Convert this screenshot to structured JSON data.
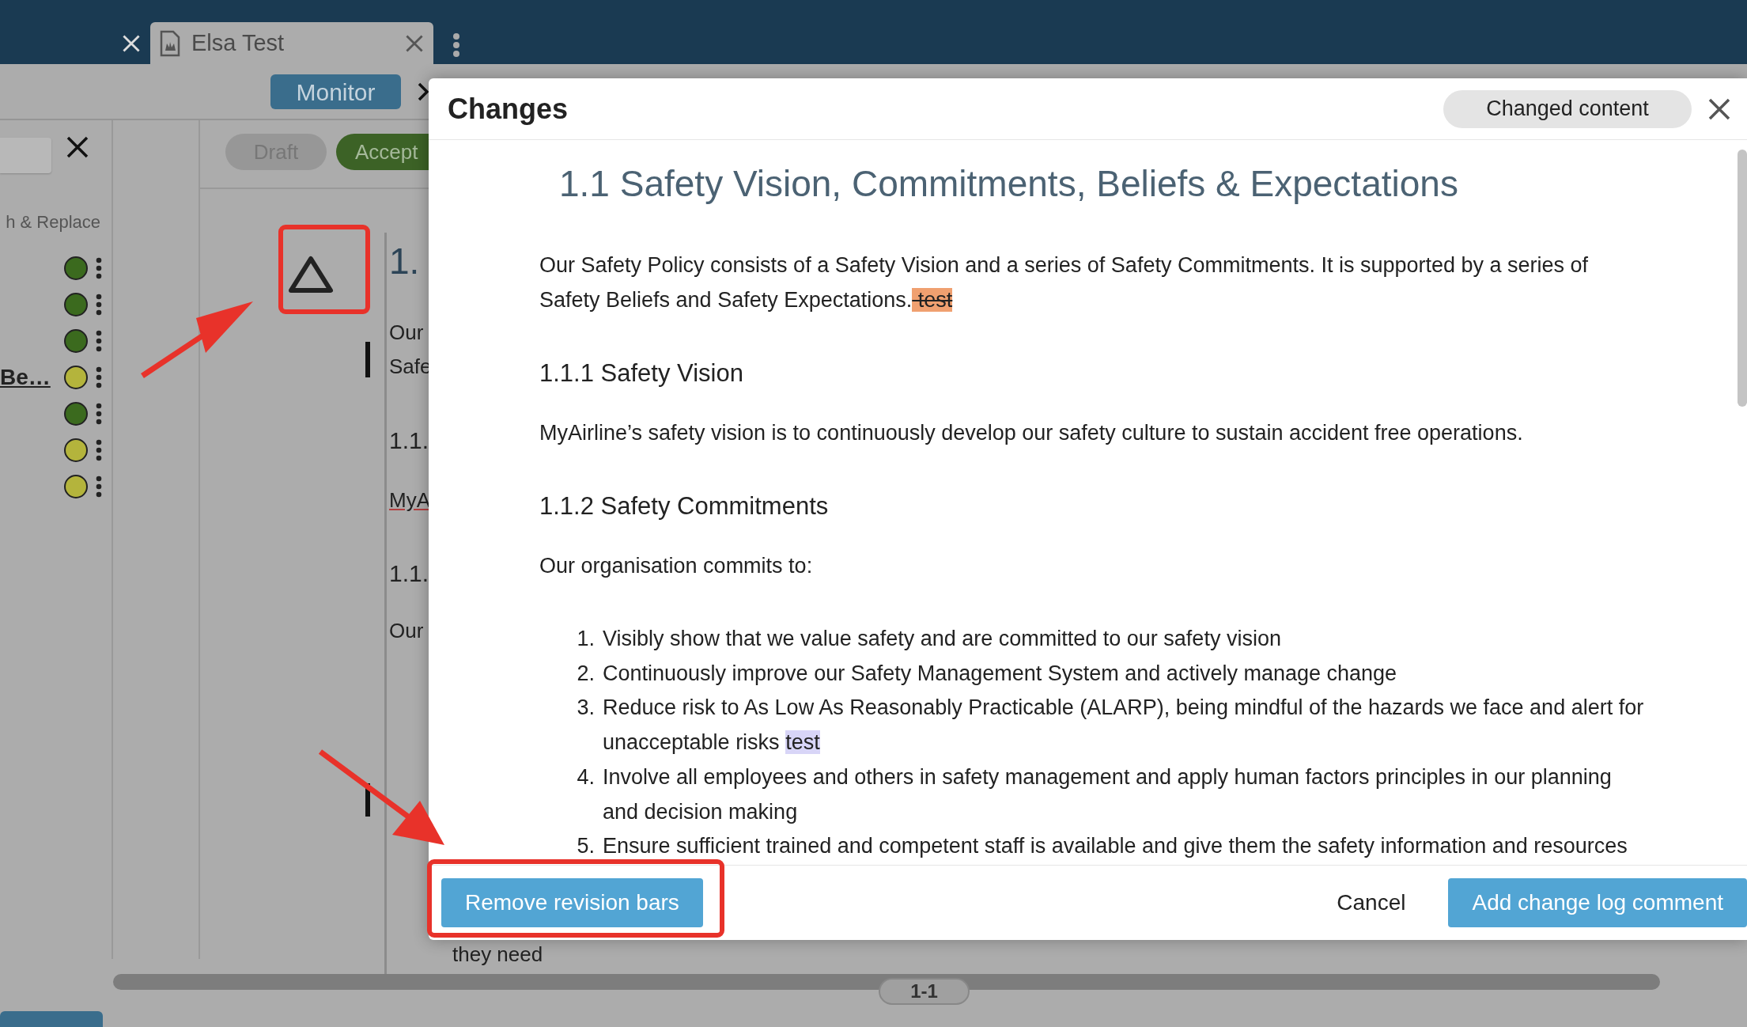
{
  "browser_tabs": [
    {
      "selected": false
    },
    {
      "label": "Elsa Test",
      "selected": true
    }
  ],
  "workflow": {
    "stage": "Monitor"
  },
  "sidebar": {
    "section_label": "h & Replace",
    "items": [
      {
        "color": "#3b6a1e"
      },
      {
        "color": "#3b6a1e"
      },
      {
        "color": "#3b6a1e"
      },
      {
        "label": "Be…",
        "color": "#b4b43c"
      },
      {
        "color": "#3b6a1e"
      },
      {
        "color": "#b4b43c"
      },
      {
        "color": "#b4b43c"
      }
    ]
  },
  "status_pills": [
    {
      "label": "Draft",
      "kind": "draft"
    },
    {
      "label": "Accept",
      "kind": "accept"
    }
  ],
  "document_peek": [
    {
      "text": "1.",
      "kind": "heading"
    },
    {
      "text": "Our",
      "kind": "text"
    },
    {
      "text": "Safe",
      "kind": "text"
    },
    {
      "text": "1.1.",
      "kind": "subheading"
    },
    {
      "text": "MyA",
      "kind": "link"
    },
    {
      "text": "1.1.",
      "kind": "subheading"
    },
    {
      "text": "Our",
      "kind": "text"
    },
    {
      "text": "they need",
      "kind": "indent"
    }
  ],
  "pager": "1-1",
  "modal": {
    "title": "Changes",
    "filter": "Changed content",
    "heading": "1.1 Safety Vision, Commitments, Beliefs & Expectations",
    "blocks": [
      {
        "kind": "paragraph",
        "segments": [
          {
            "text": "Our Safety Policy consists of a Safety Vision and a series of Safety Commitments. It is supported by a series of Safety Beliefs and Safety Expectations.",
            "deleted": false,
            "inserted": false
          },
          {
            "text": " test",
            "deleted": true,
            "inserted": false
          }
        ]
      },
      {
        "kind": "heading",
        "text": "1.1.1 Safety Vision"
      },
      {
        "kind": "paragraph",
        "segments": [
          {
            "text": "MyAirline’s safety vision is to continuously develop our safety culture to sustain accident free operations.",
            "deleted": false,
            "inserted": false
          }
        ]
      },
      {
        "kind": "heading",
        "text": "1.1.2 Safety Commitments"
      },
      {
        "kind": "paragraph",
        "segments": [
          {
            "text": "Our organisation commits to:",
            "deleted": false,
            "inserted": false
          }
        ]
      },
      {
        "kind": "list",
        "items": [
          {
            "number": "1.",
            "segments": [
              {
                "text": "Visibly show that we value safety and are committed to our safety vision",
                "deleted": false,
                "inserted": false
              }
            ]
          },
          {
            "number": "2.",
            "segments": [
              {
                "text": "Continuously improve our Safety Management System and actively manage change",
                "deleted": false,
                "inserted": false
              }
            ]
          },
          {
            "number": "3.",
            "segments": [
              {
                "text": "Reduce risk to As Low As Reasonably Practicable (ALARP), being mindful of the hazards we face and alert for unacceptable risks ",
                "deleted": false,
                "inserted": false
              },
              {
                "text": "test",
                "deleted": false,
                "inserted": true
              }
            ]
          },
          {
            "number": "4.",
            "segments": [
              {
                "text": "Involve all employees and others in safety management and apply human factors principles in our planning and decision making",
                "deleted": false,
                "inserted": false
              }
            ]
          },
          {
            "number": "5.",
            "segments": [
              {
                "text": "Ensure sufficient trained and competent staff is available and give them the safety information and resources",
                "deleted": false,
                "inserted": false
              }
            ]
          }
        ]
      }
    ],
    "buttons": [
      {
        "label": "Remove revision bars",
        "kind": "primary"
      },
      {
        "label": "Cancel",
        "kind": "plain"
      },
      {
        "label": "Add change log comment",
        "kind": "primary"
      }
    ]
  }
}
